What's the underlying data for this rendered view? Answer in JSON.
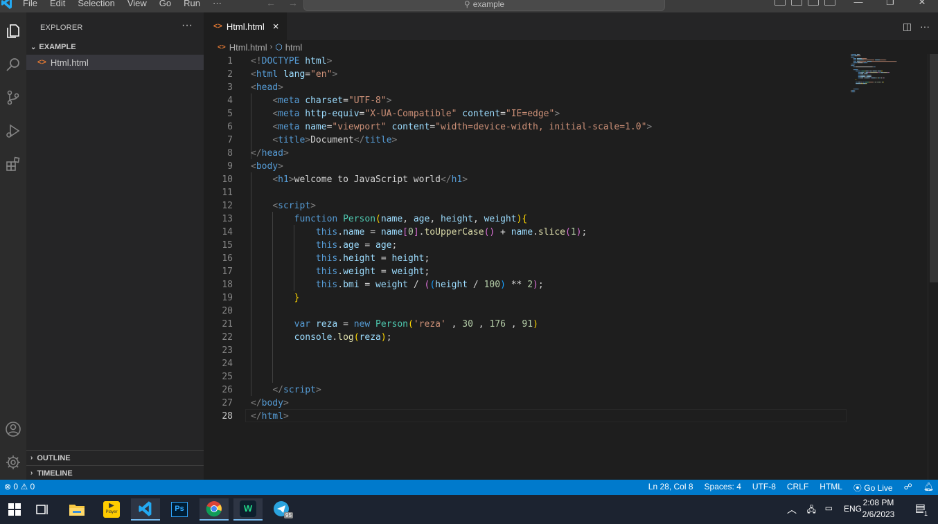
{
  "title_bar": {
    "menus": [
      "File",
      "Edit",
      "Selection",
      "View",
      "Go",
      "Run",
      "···"
    ],
    "command_center": "example"
  },
  "sidebar": {
    "header": "EXPLORER",
    "more": "···",
    "folder": "EXAMPLE",
    "file_icon": "<>",
    "file": "Html.html",
    "outline": "OUTLINE",
    "timeline": "TIMELINE"
  },
  "tab": {
    "icon": "<>",
    "label": "Html.html",
    "close": "×"
  },
  "breadcrumb": {
    "icon": "<>",
    "file": "Html.html",
    "sep": "›",
    "symbol": "html"
  },
  "editor": {
    "line_numbers": [
      "1",
      "2",
      "3",
      "4",
      "5",
      "6",
      "7",
      "8",
      "9",
      "10",
      "11",
      "12",
      "13",
      "14",
      "15",
      "16",
      "17",
      "18",
      "19",
      "20",
      "21",
      "22",
      "23",
      "24",
      "25",
      "26",
      "27",
      "28"
    ],
    "lines": [
      [
        [
          "t",
          "<!"
        ],
        [
          "tg",
          "DOCTYPE"
        ],
        [
          "at",
          " html"
        ],
        [
          "t",
          ">"
        ]
      ],
      [
        [
          "t",
          "<"
        ],
        [
          "tg",
          "html"
        ],
        [
          "at",
          " lang"
        ],
        [
          "p",
          "="
        ],
        [
          "s",
          "\"en\""
        ],
        [
          "t",
          ">"
        ]
      ],
      [
        [
          "t",
          "<"
        ],
        [
          "tg",
          "head"
        ],
        [
          "t",
          ">"
        ]
      ],
      [
        [
          "p",
          "    "
        ],
        [
          "t",
          "<"
        ],
        [
          "tg",
          "meta"
        ],
        [
          "at",
          " charset"
        ],
        [
          "p",
          "="
        ],
        [
          "s",
          "\"UTF-8\""
        ],
        [
          "t",
          ">"
        ]
      ],
      [
        [
          "p",
          "    "
        ],
        [
          "t",
          "<"
        ],
        [
          "tg",
          "meta"
        ],
        [
          "at",
          " http-equiv"
        ],
        [
          "p",
          "="
        ],
        [
          "s",
          "\"X-UA-Compatible\""
        ],
        [
          "at",
          " content"
        ],
        [
          "p",
          "="
        ],
        [
          "s",
          "\"IE=edge\""
        ],
        [
          "t",
          ">"
        ]
      ],
      [
        [
          "p",
          "    "
        ],
        [
          "t",
          "<"
        ],
        [
          "tg",
          "meta"
        ],
        [
          "at",
          " name"
        ],
        [
          "p",
          "="
        ],
        [
          "s",
          "\"viewport\""
        ],
        [
          "at",
          " content"
        ],
        [
          "p",
          "="
        ],
        [
          "s",
          "\"width=device-width, initial-scale=1.0\""
        ],
        [
          "t",
          ">"
        ]
      ],
      [
        [
          "p",
          "    "
        ],
        [
          "t",
          "<"
        ],
        [
          "tg",
          "title"
        ],
        [
          "t",
          ">"
        ],
        [
          "p",
          "Document"
        ],
        [
          "t",
          "</"
        ],
        [
          "tg",
          "title"
        ],
        [
          "t",
          ">"
        ]
      ],
      [
        [
          "t",
          "</"
        ],
        [
          "tg",
          "head"
        ],
        [
          "t",
          ">"
        ]
      ],
      [
        [
          "t",
          "<"
        ],
        [
          "tg",
          "body"
        ],
        [
          "t",
          ">"
        ]
      ],
      [
        [
          "p",
          "    "
        ],
        [
          "t",
          "<"
        ],
        [
          "tg",
          "h1"
        ],
        [
          "t",
          ">"
        ],
        [
          "p",
          "welcome to JavaScript world"
        ],
        [
          "t",
          "</"
        ],
        [
          "tg",
          "h1"
        ],
        [
          "t",
          ">"
        ]
      ],
      [],
      [
        [
          "p",
          "    "
        ],
        [
          "t",
          "<"
        ],
        [
          "tg",
          "script"
        ],
        [
          "t",
          ">"
        ]
      ],
      [
        [
          "p",
          "        "
        ],
        [
          "k",
          "function"
        ],
        [
          "p",
          " "
        ],
        [
          "c",
          "Person"
        ],
        [
          "y",
          "("
        ],
        [
          "v",
          "name"
        ],
        [
          "p",
          ", "
        ],
        [
          "v",
          "age"
        ],
        [
          "p",
          ", "
        ],
        [
          "v",
          "height"
        ],
        [
          "p",
          ", "
        ],
        [
          "v",
          "weight"
        ],
        [
          "y",
          ")"
        ],
        [
          "y",
          "{"
        ]
      ],
      [
        [
          "p",
          "            "
        ],
        [
          "k",
          "this"
        ],
        [
          "p",
          "."
        ],
        [
          "v",
          "name"
        ],
        [
          "p",
          " = "
        ],
        [
          "v",
          "name"
        ],
        [
          "m",
          "["
        ],
        [
          "n",
          "0"
        ],
        [
          "m",
          "]"
        ],
        [
          "p",
          "."
        ],
        [
          "f",
          "toUpperCase"
        ],
        [
          "m",
          "()"
        ],
        [
          "p",
          " + "
        ],
        [
          "v",
          "name"
        ],
        [
          "p",
          "."
        ],
        [
          "f",
          "slice"
        ],
        [
          "m",
          "("
        ],
        [
          "n",
          "1"
        ],
        [
          "m",
          ")"
        ],
        [
          "p",
          ";"
        ]
      ],
      [
        [
          "p",
          "            "
        ],
        [
          "k",
          "this"
        ],
        [
          "p",
          "."
        ],
        [
          "v",
          "age"
        ],
        [
          "p",
          " = "
        ],
        [
          "v",
          "age"
        ],
        [
          "p",
          ";"
        ]
      ],
      [
        [
          "p",
          "            "
        ],
        [
          "k",
          "this"
        ],
        [
          "p",
          "."
        ],
        [
          "v",
          "height"
        ],
        [
          "p",
          " = "
        ],
        [
          "v",
          "height"
        ],
        [
          "p",
          ";"
        ]
      ],
      [
        [
          "p",
          "            "
        ],
        [
          "k",
          "this"
        ],
        [
          "p",
          "."
        ],
        [
          "v",
          "weight"
        ],
        [
          "p",
          " = "
        ],
        [
          "v",
          "weight"
        ],
        [
          "p",
          ";"
        ]
      ],
      [
        [
          "p",
          "            "
        ],
        [
          "k",
          "this"
        ],
        [
          "p",
          "."
        ],
        [
          "v",
          "bmi"
        ],
        [
          "p",
          " = "
        ],
        [
          "v",
          "weight"
        ],
        [
          "p",
          " / "
        ],
        [
          "m",
          "("
        ],
        [
          "b",
          "("
        ],
        [
          "v",
          "height"
        ],
        [
          "p",
          " / "
        ],
        [
          "n",
          "100"
        ],
        [
          "b",
          ")"
        ],
        [
          "p",
          " ** "
        ],
        [
          "n",
          "2"
        ],
        [
          "m",
          ")"
        ],
        [
          "p",
          ";"
        ]
      ],
      [
        [
          "p",
          "        "
        ],
        [
          "y",
          "}"
        ]
      ],
      [],
      [
        [
          "p",
          "        "
        ],
        [
          "k",
          "var"
        ],
        [
          "p",
          " "
        ],
        [
          "v",
          "reza"
        ],
        [
          "p",
          " = "
        ],
        [
          "k",
          "new"
        ],
        [
          "p",
          " "
        ],
        [
          "c",
          "Person"
        ],
        [
          "y",
          "("
        ],
        [
          "s",
          "'reza'"
        ],
        [
          "p",
          " , "
        ],
        [
          "n",
          "30"
        ],
        [
          "p",
          " , "
        ],
        [
          "n",
          "176"
        ],
        [
          "p",
          " , "
        ],
        [
          "n",
          "91"
        ],
        [
          "y",
          ")"
        ]
      ],
      [
        [
          "p",
          "        "
        ],
        [
          "v",
          "console"
        ],
        [
          "p",
          "."
        ],
        [
          "f",
          "log"
        ],
        [
          "y",
          "("
        ],
        [
          "v",
          "reza"
        ],
        [
          "y",
          ")"
        ],
        [
          "p",
          ";"
        ]
      ],
      [],
      [],
      [],
      [
        [
          "p",
          "    "
        ],
        [
          "t",
          "</"
        ],
        [
          "tg",
          "script"
        ],
        [
          "t",
          ">"
        ]
      ],
      [
        [
          "t",
          "</"
        ],
        [
          "tg",
          "body"
        ],
        [
          "t",
          ">"
        ]
      ],
      [
        [
          "t",
          "</"
        ],
        [
          "tg",
          "html"
        ],
        [
          "t",
          ">"
        ]
      ]
    ],
    "current_line": "28"
  },
  "colors": {
    "t": "#808080",
    "tg": "#569cd6",
    "at": "#9cdcfe",
    "s": "#ce9178",
    "k": "#569cd6",
    "f": "#dcdcaa",
    "c": "#4ec9b0",
    "n": "#b5cea8",
    "p": "#d4d4d4",
    "v": "#9cdcfe",
    "y": "#ffd700",
    "m": "#da70d6",
    "b": "#179fff",
    "status_bar": "#007acc",
    "accent_orange": "#e37933"
  },
  "status_bar": {
    "errors": "0",
    "warnings": "0",
    "position": "Ln 28, Col 8",
    "spaces": "Spaces: 4",
    "encoding": "UTF-8",
    "eol": "CRLF",
    "language": "HTML",
    "go_live": "Go Live"
  },
  "taskbar": {
    "app_badge": "95",
    "player_label": "Player",
    "lang": "ENG",
    "time": "2:08 PM",
    "date": "2/6/2023",
    "notifications": "1"
  }
}
